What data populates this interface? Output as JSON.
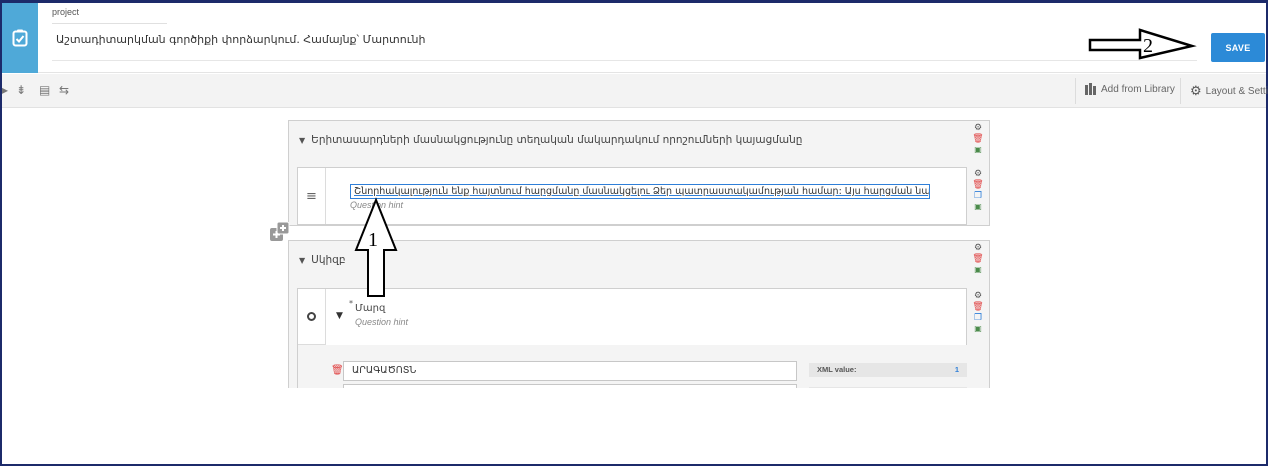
{
  "header": {
    "project_label": "project",
    "project_title": "Աշտադիտարկման գործիքի փորձարկում. Համայնք՝ Մարտունի",
    "save_label": "SAVE"
  },
  "toolbar": {
    "add_from_library": "Add from Library",
    "layout_settings": "Layout & Setti"
  },
  "form": {
    "group1": {
      "title": "Երիտասարդների մասնակցությունը տեղական մակարդակում որոշումների կայացմանը",
      "question": {
        "text": "Շնորհակալություն ենք հայտնում հարցմանը մասնակցելու Ձեր պատրաստակամության համար: Այս հարցման նպատակն է ուսո",
        "hint": "Question hint"
      }
    },
    "group2": {
      "title": "Սկիզբ",
      "question": {
        "required_mark": "*",
        "label": "Մարզ",
        "hint": "Question hint",
        "choices": [
          {
            "label": "ԱՐԱԳԱԾՈՏՆ",
            "xml_label": "XML value:",
            "xml_value": "1"
          }
        ]
      }
    }
  },
  "annotations": {
    "arrow1_number": "1",
    "arrow2_number": "2"
  },
  "colors": {
    "accent": "#2c8ad7",
    "logo_bg": "#4fa9d8",
    "delete": "#e04343",
    "frame_border": "#1c2a6a"
  }
}
